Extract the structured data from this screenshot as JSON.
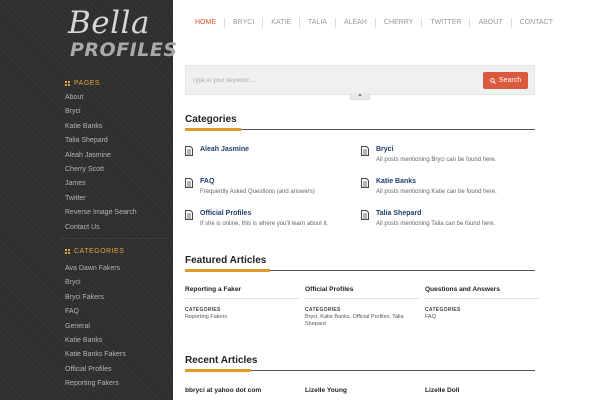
{
  "logo": {
    "script": "Bella",
    "block": "PROFILES"
  },
  "sidebar": {
    "pages_heading": "PAGES",
    "pages": [
      "About",
      "Bryci",
      "Katie Banks",
      "Talia Shepard",
      "Aleah Jasmine",
      "Cherry Scott",
      "James",
      "Twitter",
      "Reverse Image Search",
      "Contact Us"
    ],
    "categories_heading": "CATEGORIES",
    "categories": [
      "Ava Dawn Fakers",
      "Bryci",
      "Bryci Fakers",
      "FAQ",
      "General",
      "Katie Banks",
      "Katie Banks Fakers",
      "Official Profiles",
      "Reporting Fakers"
    ]
  },
  "nav": [
    "HOME",
    "BRYCI",
    "KATIE",
    "TALIA",
    "ALEAH",
    "CHERRY",
    "TWITTER",
    "ABOUT",
    "CONTACT"
  ],
  "search": {
    "placeholder": "Type in your keyword ...",
    "button": "Search",
    "toggle": "▲"
  },
  "categories_section": {
    "title": "Categories",
    "items": [
      {
        "name": "Aleah Jasmine",
        "desc": ""
      },
      {
        "name": "Bryci",
        "desc": "All posts mentioning Bryci can be found here."
      },
      {
        "name": "FAQ",
        "desc": "Frequently Asked Questions (and answers)"
      },
      {
        "name": "Katie Banks",
        "desc": "All posts mentioning Katie can be found here."
      },
      {
        "name": "Official Profiles",
        "desc": "If she is online, this is where you'll learn about it."
      },
      {
        "name": "Talia Shepard",
        "desc": "All posts mentioning Talia can be found here."
      }
    ]
  },
  "featured": {
    "title": "Featured Articles",
    "columns": [
      {
        "title": "Reporting a Faker",
        "label": "CATEGORIES",
        "value": "Reporting Fakers"
      },
      {
        "title": "Official Profiles",
        "label": "CATEGORIES",
        "value": "Bryci, Katie Banks, Official Profiles, Talia Shepard"
      },
      {
        "title": "Questions and Answers",
        "label": "CATEGORIES",
        "value": "FAQ"
      }
    ]
  },
  "recent": {
    "title": "Recent Articles",
    "items": [
      "bbryci at yahoo dot com",
      "Lizelle Young",
      "Lizelle Doll"
    ]
  },
  "colors": {
    "accent": "#e19a2c",
    "nav_active": "#d9552a",
    "search_button": "#d95a3c",
    "sidebar_bg": "#2e2e2e",
    "link": "#1f3d6e"
  }
}
